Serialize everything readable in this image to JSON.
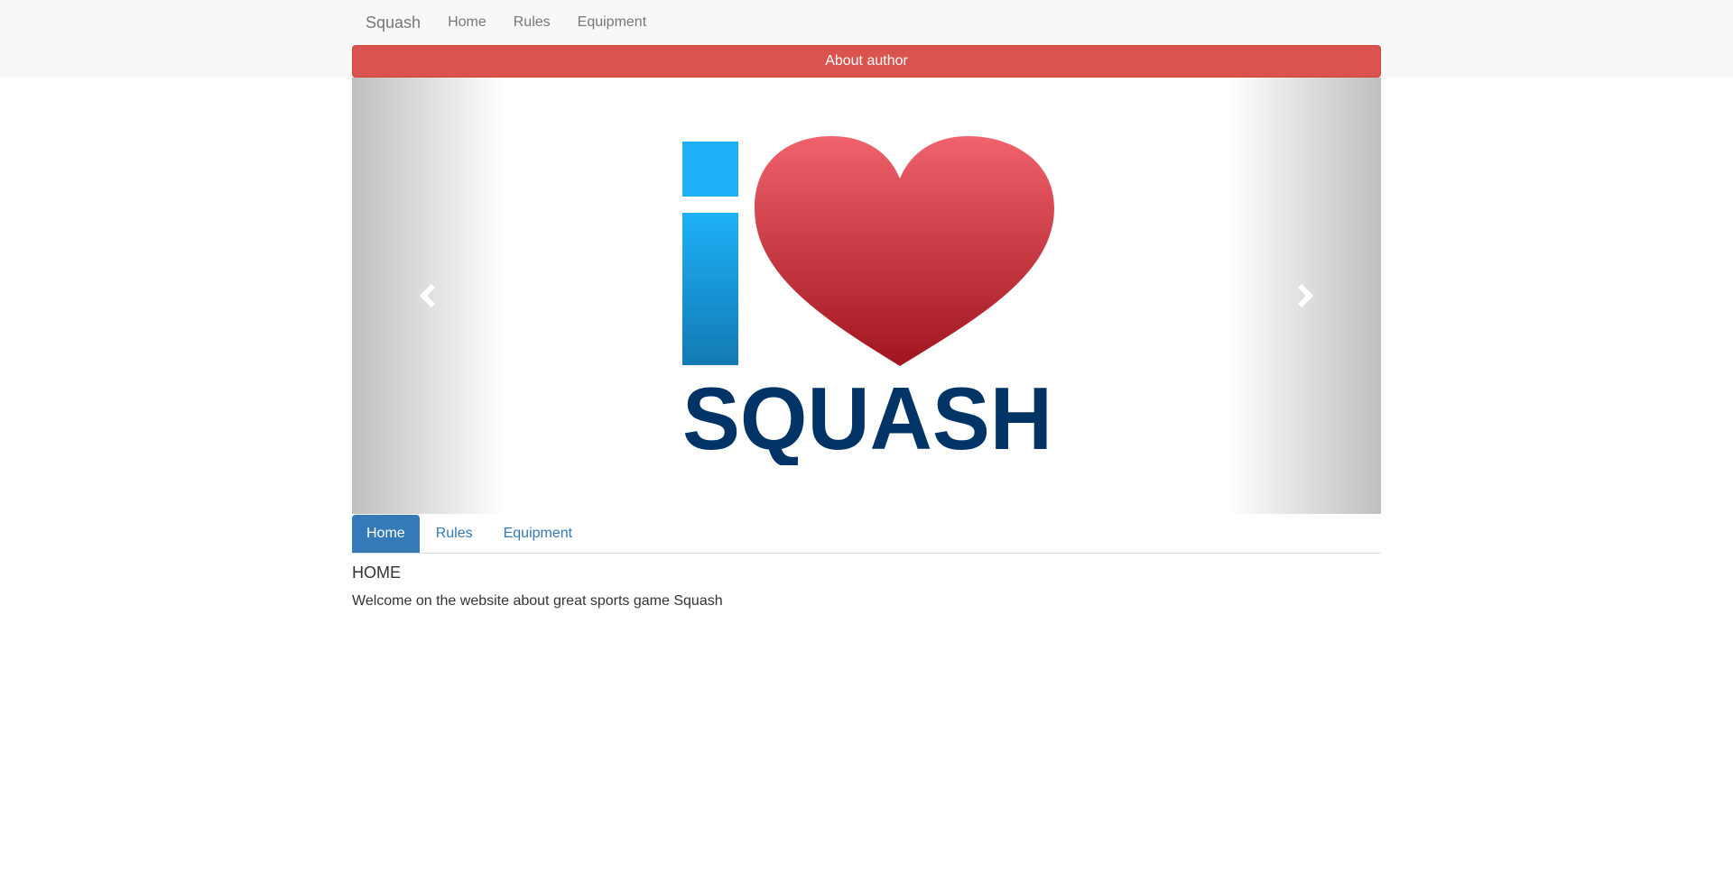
{
  "navbar": {
    "brand": "Squash",
    "links": [
      "Home",
      "Rules",
      "Equipment"
    ]
  },
  "about_button": "About author",
  "carousel": {
    "logo": {
      "letter": "i",
      "word": "SQUASH",
      "icon": "heart-icon"
    },
    "prev_icon": "chevron-left-icon",
    "next_icon": "chevron-right-icon"
  },
  "tabs": [
    {
      "label": "Home",
      "active": true
    },
    {
      "label": "Rules",
      "active": false
    },
    {
      "label": "Equipment",
      "active": false
    }
  ],
  "content": {
    "title": "HOME",
    "text": "Welcome on the website about great sports game Squash"
  },
  "colors": {
    "danger": "#d9534f",
    "primary": "#337ab7",
    "logo_blue_light": "#1eb1f8",
    "logo_blue_dark": "#003366",
    "heart_top": "#f0626c",
    "heart_bottom": "#a0151f"
  }
}
